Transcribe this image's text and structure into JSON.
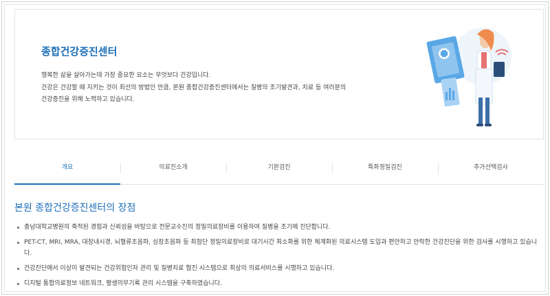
{
  "hero": {
    "title": "종합건강증진센터",
    "desc": [
      "행복한 삶을 살아가는데 가장 중요한 요소는 무엇보다 건강입니다.",
      "건강은 건강할 때 지키는 것이 최선의 방법인 만큼, 본원 종합건강증진센터에서는 질병의 조기발견과, 치료 등 여러분의",
      "건강증진을 위해 노력하고 있습니다."
    ]
  },
  "tabs": [
    {
      "label": "개요",
      "active": true
    },
    {
      "label": "의료진소개",
      "active": false
    },
    {
      "label": "기본검진",
      "active": false
    },
    {
      "label": "특화정밀검진",
      "active": false
    },
    {
      "label": "추가선택검사",
      "active": false
    }
  ],
  "section": {
    "title": "본원 종합건강증진센터의 장점",
    "bullets": [
      "충남대학교병원의 축적된 경험과 신뢰성을 바탕으로 전문교수진의 정밀의료장비를 이용하여 질병을 조기에 진단합니다.",
      "PET-CT, MRI, MRA, 대장내시경, 뇌혈류초음파, 심장초음파 등 최첨단 정밀의료장비로 대기시간 최소화를 위한 체계화된 의료시스템 도입과 편안하고 안락한 건강진단을 위한 검사를 시행하고 있습니다.",
      "건강진단에서 이상이 발견되는 건강위험인자 관리 및 질병치료 협진 시스템으로 최상의 의료서비스를 시행하고 있습니다.",
      "디지털 통합의료정보 네트워크, 평생의무기록 관리 시스템을 구축하였습니다."
    ]
  },
  "colors": {
    "accent": "#1d6fb8",
    "illustration_blue": "#5aa7e6"
  },
  "icons": {
    "illustration": "doctor-with-medical-chart-illustration"
  }
}
